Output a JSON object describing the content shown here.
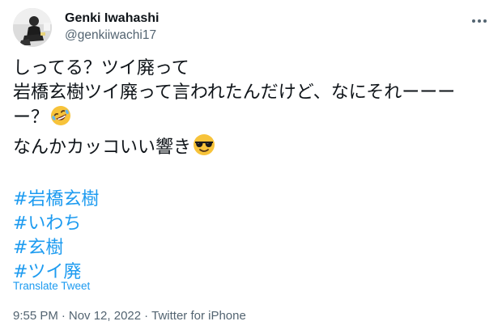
{
  "author": {
    "display_name": "Genki Iwahashi",
    "handle": "@genkiiwachi17"
  },
  "icons": {
    "more": "more-horizontal-icon",
    "emoji_1": "rolling-on-floor-laughing-emoji",
    "emoji_2": "smiling-face-with-sunglasses-emoji"
  },
  "tweet": {
    "lines": [
      "しってる？ツイ廃って",
      "岩橋玄樹ツイ廃って言われたんだけど、なにそれーーー",
      "ー？",
      "なんかカッコいい響き"
    ],
    "hashtags": [
      "#岩橋玄樹",
      "#いわち",
      "#玄樹",
      "#ツイ廃"
    ],
    "translate_label": "Translate Tweet"
  },
  "meta": {
    "time": "9:55 PM",
    "date": "Nov 12, 2022",
    "source": "Twitter for iPhone",
    "separator": "·"
  },
  "colors": {
    "text": "#0f1419",
    "secondary": "#536471",
    "link": "#1d9bf0",
    "background": "#ffffff"
  }
}
